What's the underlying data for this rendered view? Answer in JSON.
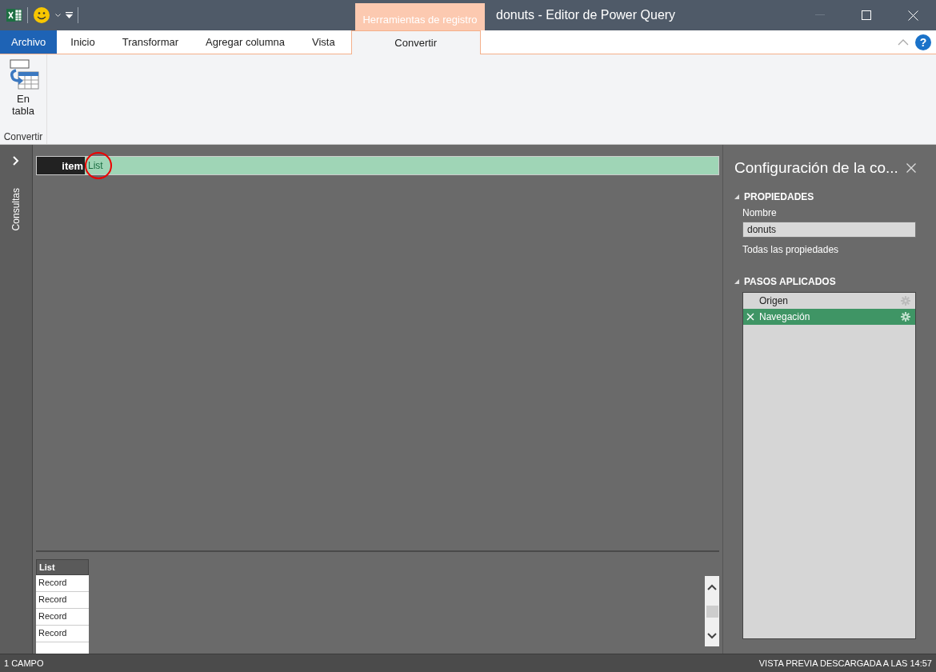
{
  "window": {
    "title": "donuts - Editor de Power Query",
    "contextual_tab": "Herramientas de registro"
  },
  "tabs": [
    {
      "label": "Archivo",
      "kind": "file",
      "selected": false
    },
    {
      "label": "Inicio",
      "kind": "tab",
      "selected": false
    },
    {
      "label": "Transformar",
      "kind": "tab",
      "selected": false
    },
    {
      "label": "Agregar columna",
      "kind": "tab",
      "selected": false
    },
    {
      "label": "Vista",
      "kind": "tab",
      "selected": false
    },
    {
      "label": "Convertir",
      "kind": "contextual",
      "selected": true
    }
  ],
  "help_button": {
    "label": "?"
  },
  "ribbon": {
    "groups": [
      {
        "label": "Convertir",
        "buttons": [
          {
            "label": "En tabla"
          }
        ]
      }
    ]
  },
  "queries_pane": {
    "label": "Consultas",
    "expanded": false
  },
  "record": {
    "fields": [
      {
        "name": "item",
        "value": "List"
      }
    ]
  },
  "preview": {
    "header": "List",
    "rows": [
      "Record",
      "Record",
      "Record",
      "Record"
    ]
  },
  "settings": {
    "title": "Configuración de la co...",
    "properties": {
      "heading": "PROPIEDADES",
      "name_label": "Nombre",
      "name_value": "donuts",
      "all_properties": "Todas las propiedades"
    },
    "steps": {
      "heading": "PASOS APLICADOS",
      "items": [
        {
          "label": "Origen",
          "selected": false
        },
        {
          "label": "Navegación",
          "selected": true
        }
      ]
    }
  },
  "status_bar": {
    "left": "1 CAMPO",
    "right": "VISTA PREVIA DESCARGADA A LAS 14:57"
  }
}
